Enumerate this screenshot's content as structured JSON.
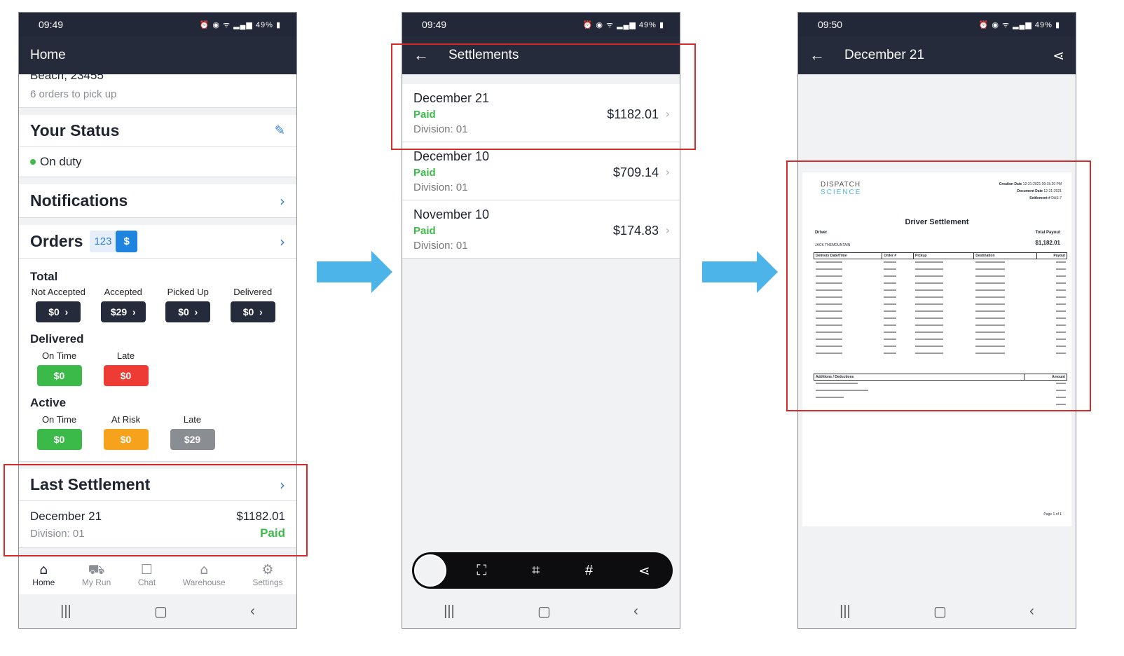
{
  "phone1": {
    "status_time": "09:49",
    "battery": "49%",
    "title": "Home",
    "address_partial": "Beach, 23455",
    "orders_to_pick": "6 orders to pick up",
    "your_status_title": "Your Status",
    "duty_status": "On duty",
    "notifications_title": "Notifications",
    "orders_title": "Orders",
    "orders_count_badge": "123",
    "orders_dollar_badge": "$",
    "total_title": "Total",
    "total_cols": [
      {
        "label": "Not Accepted",
        "value": "$0"
      },
      {
        "label": "Accepted",
        "value": "$29"
      },
      {
        "label": "Picked Up",
        "value": "$0"
      },
      {
        "label": "Delivered",
        "value": "$0"
      }
    ],
    "delivered_title": "Delivered",
    "delivered_cols": [
      {
        "label": "On Time",
        "value": "$0"
      },
      {
        "label": "Late",
        "value": "$0"
      }
    ],
    "active_title": "Active",
    "active_cols": [
      {
        "label": "On Time",
        "value": "$0"
      },
      {
        "label": "At Risk",
        "value": "$0"
      },
      {
        "label": "Late",
        "value": "$29"
      }
    ],
    "last_settlement_title": "Last Settlement",
    "last_settlement": {
      "date": "December 21",
      "amount": "$1182.01",
      "division": "Division: 01",
      "status": "Paid"
    },
    "tabs": [
      "Home",
      "My Run",
      "Chat",
      "Warehouse",
      "Settings"
    ]
  },
  "phone2": {
    "status_time": "09:49",
    "battery": "49%",
    "title": "Settlements",
    "items": [
      {
        "date": "December 21",
        "status": "Paid",
        "division": "Division: 01",
        "amount": "$1182.01"
      },
      {
        "date": "December 10",
        "status": "Paid",
        "division": "Division: 01",
        "amount": "$709.14"
      },
      {
        "date": "November 10",
        "status": "Paid",
        "division": "Division: 01",
        "amount": "$174.83"
      }
    ],
    "toolbar_hash": "#"
  },
  "phone3": {
    "status_time": "09:50",
    "battery": "49%",
    "title": "December 21",
    "doc": {
      "logo_top": "DISPATCH",
      "logo_bottom": "SCIENCE",
      "meta_labels": [
        "Creation Date",
        "Document Date",
        "Settlement #"
      ],
      "meta_values": [
        "12-21-2021 09:15:20 PM",
        "12-21-2021",
        "DAS-7"
      ],
      "heading": "Driver Settlement",
      "driver_label": "Driver",
      "driver_name": "JACK THEMOUNTAIN",
      "total_payout_label": "Total Payout",
      "total_payout": "$1,182.01",
      "headers": [
        "Delivery Date/Time",
        "Order #",
        "Pickup",
        "Destination",
        "Payout"
      ],
      "adj_headers": [
        "Additions / Deductions",
        "Amount"
      ],
      "page": "Page 1 of 1"
    }
  },
  "colors": {
    "appbar": "#262b3b",
    "paid_green": "#3dbb4a",
    "link_blue": "#2f7fd6",
    "highlight_red": "#d42a2a",
    "arrow_blue": "#4cb4e8"
  }
}
